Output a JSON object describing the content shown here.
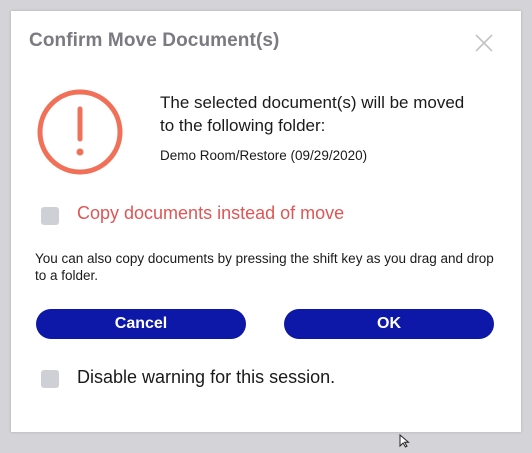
{
  "dialog": {
    "title": "Confirm Move Document(s)",
    "close_icon": "close-icon",
    "alert_icon": "exclamation-circle-icon",
    "alert_color": "#f07058",
    "message": "The selected document(s) will be moved to the following folder:",
    "destination_path": "Demo Room/Restore (09/29/2020)",
    "copy_option": {
      "label": "Copy documents instead of move",
      "checked": false,
      "color": "#e05555"
    },
    "hint": "You can also copy documents by pressing the shift key as you drag and drop to a folder.",
    "buttons": {
      "cancel_label": "Cancel",
      "ok_label": "OK",
      "color": "#0e18a8"
    },
    "disable_option": {
      "label": "Disable warning for this session.",
      "checked": false
    }
  }
}
